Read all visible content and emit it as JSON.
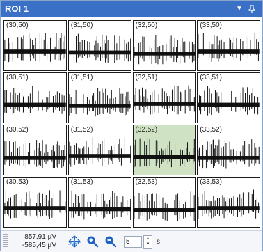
{
  "window": {
    "title": "ROI 1"
  },
  "cells": [
    {
      "label": "(30,50)",
      "selected": false
    },
    {
      "label": "(31,50)",
      "selected": false
    },
    {
      "label": "(32,50)",
      "selected": false
    },
    {
      "label": "(33,50)",
      "selected": false
    },
    {
      "label": "(30,51)",
      "selected": false
    },
    {
      "label": "(31,51)",
      "selected": false
    },
    {
      "label": "(32,51)",
      "selected": false
    },
    {
      "label": "(33,51)",
      "selected": false
    },
    {
      "label": "(30,52)",
      "selected": false
    },
    {
      "label": "(31,52)",
      "selected": false
    },
    {
      "label": "(32,52)",
      "selected": true
    },
    {
      "label": "(33,52)",
      "selected": false
    },
    {
      "label": "(30,53)",
      "selected": false
    },
    {
      "label": "(31,53)",
      "selected": false
    },
    {
      "label": "(32,53)",
      "selected": false
    },
    {
      "label": "(33,53)",
      "selected": false
    }
  ],
  "status": {
    "max_value": "857,91 µV",
    "min_value": "-585,45 µV",
    "time_window": "5",
    "time_unit": "s"
  },
  "colors": {
    "title_bar": "#3b70c7",
    "selected_cell": "#cfe3c4",
    "icon_blue": "#1f63c4"
  }
}
